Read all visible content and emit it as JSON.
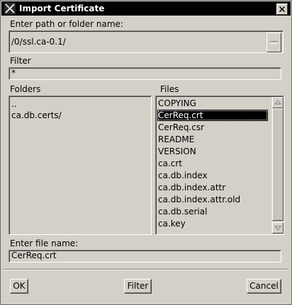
{
  "window": {
    "title": "Import Certificate",
    "close_glyph": "✕"
  },
  "path_section": {
    "label": "Enter path or folder name:",
    "value": "/0/ssl.ca-0.1/"
  },
  "filter_section": {
    "label": "Filter",
    "value": "*"
  },
  "folders": {
    "label": "Folders",
    "items": [
      "..",
      "ca.db.certs/"
    ]
  },
  "files": {
    "label": "Files",
    "items": [
      "COPYING",
      "CerReq.crt",
      "CerReq.csr",
      "README",
      "VERSION",
      "ca.crt",
      "ca.db.index",
      "ca.db.index.attr",
      "ca.db.index.attr.old",
      "ca.db.serial",
      "ca.key"
    ],
    "selected": "CerReq.crt"
  },
  "filename_section": {
    "label": "Enter file name:",
    "value": "CerReq.crt"
  },
  "buttons": {
    "ok": "OK",
    "filter": "Filter",
    "cancel": "Cancel"
  },
  "colors": {
    "titlebar": "#000000",
    "background": "#d4d0c8",
    "selection": "#000000"
  },
  "icons": {
    "app": "x-window-icon",
    "close": "close-icon",
    "scroll_up": "arrow-up-icon",
    "scroll_down": "arrow-down-icon"
  }
}
